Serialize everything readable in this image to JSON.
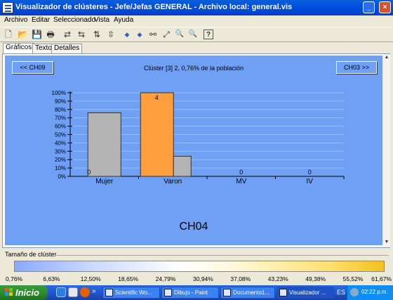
{
  "window": {
    "title": "Visualizador de clústeres - Jefe/Jefas GENERAL - Archivo local: general.vis",
    "controls": {
      "minimize": "_",
      "maximize": "□",
      "close": "×"
    }
  },
  "menu": [
    "Archivo",
    "Editar",
    "Seleccionado",
    "Vista",
    "Ayuda"
  ],
  "toolbar": {
    "icons": [
      "new-icon",
      "open-icon",
      "save-icon",
      "print-icon",
      "swap-icon",
      "swap-reverse-icon",
      "sort-icon",
      "collapse-icon",
      "arrow-left-icon",
      "arrow-right-icon",
      "binoculars-icon",
      "zoom-fit-icon",
      "zoom-in-icon",
      "zoom-out-icon",
      "help-icon"
    ],
    "glyphs": [
      "🗋",
      "📂",
      "💾",
      "🖶",
      "⇄",
      "⇆",
      "⇅",
      "⇳",
      "◆",
      "◆",
      "⚯",
      "⤢",
      "🔍",
      "🔍",
      "?"
    ]
  },
  "tabs": [
    "Gráficos",
    "Texto",
    "Detalles"
  ],
  "panel": {
    "prev_button": "<< CH09",
    "next_button": "CH03 >>",
    "cluster_title": "Clúster [3] 2, 0,76% de la población",
    "variable_label": "CH04"
  },
  "chart_data": {
    "type": "bar",
    "categories": [
      "Mujer",
      "Varon",
      "MV",
      "IV"
    ],
    "series": [
      {
        "values": [
          76,
          0,
          0,
          0
        ],
        "color": "#b4b4b4"
      },
      {
        "values": [
          0,
          100,
          0,
          0
        ],
        "color": "#ff9e3d"
      },
      {
        "values": [
          0,
          24,
          0,
          0
        ],
        "color": "#b4b4b4"
      }
    ],
    "data_labels": [
      {
        "category": "Mujer",
        "text": "0"
      },
      {
        "category": "Varon",
        "text": "4"
      },
      {
        "category": "MV",
        "text": "0"
      },
      {
        "category": "IV",
        "text": "0"
      }
    ],
    "y_ticks": [
      "0%",
      "10%",
      "20%",
      "30%",
      "40%",
      "50%",
      "60%",
      "70%",
      "80%",
      "90%",
      "100%"
    ],
    "ylim": [
      0,
      100
    ],
    "grid": true,
    "background": "#6fa0f4"
  },
  "cluster_size": {
    "label": "Tamaño de clúster",
    "ticks": [
      "0,76%",
      "6,63%",
      "12,50%",
      "18,65%",
      "24,79%",
      "30,94%",
      "37,08%",
      "43,23%",
      "49,38%",
      "55,52%",
      "61,67%"
    ]
  },
  "taskbar": {
    "start": "Inicio",
    "more": "»",
    "items": [
      "Scientific Wo...",
      "Dibujo - Paint",
      "Documento1...",
      "Visualizador ..."
    ],
    "language": "ES",
    "clock": "02:22 p.m."
  }
}
